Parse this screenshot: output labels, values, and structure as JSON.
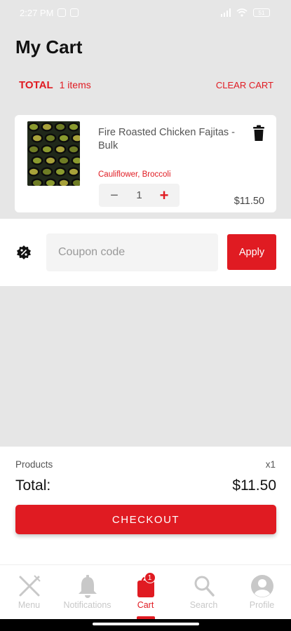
{
  "status_bar": {
    "time": "2:27 PM",
    "battery": "51"
  },
  "header": {
    "title": "My Cart"
  },
  "summary_row": {
    "total_label": "TOTAL",
    "items_count": "1 items",
    "clear_cart": "CLEAR CART"
  },
  "cart_item": {
    "name": "Fire Roasted Chicken Fajitas - Bulk",
    "options": "Cauliflower, Broccoli",
    "quantity": "1",
    "price": "$11.50",
    "minus_symbol": "−",
    "plus_symbol": "+"
  },
  "coupon": {
    "placeholder": "Coupon code",
    "apply_label": "Apply"
  },
  "order_summary": {
    "products_label": "Products",
    "products_count": "x1",
    "total_label": "Total:",
    "total_value": "$11.50",
    "checkout_label": "CHECKOUT"
  },
  "bottom_nav": [
    {
      "label": "Menu",
      "icon": "fork-knife-icon",
      "active": false
    },
    {
      "label": "Notifications",
      "icon": "bell-icon",
      "active": false
    },
    {
      "label": "Cart",
      "icon": "shopping-bag-icon",
      "active": true,
      "badge": "1"
    },
    {
      "label": "Search",
      "icon": "search-icon",
      "active": false
    },
    {
      "label": "Profile",
      "icon": "user-icon",
      "active": false
    }
  ],
  "colors": {
    "accent": "#e01b22",
    "background": "#e6e6e6",
    "inactive": "#c8c8c8"
  }
}
